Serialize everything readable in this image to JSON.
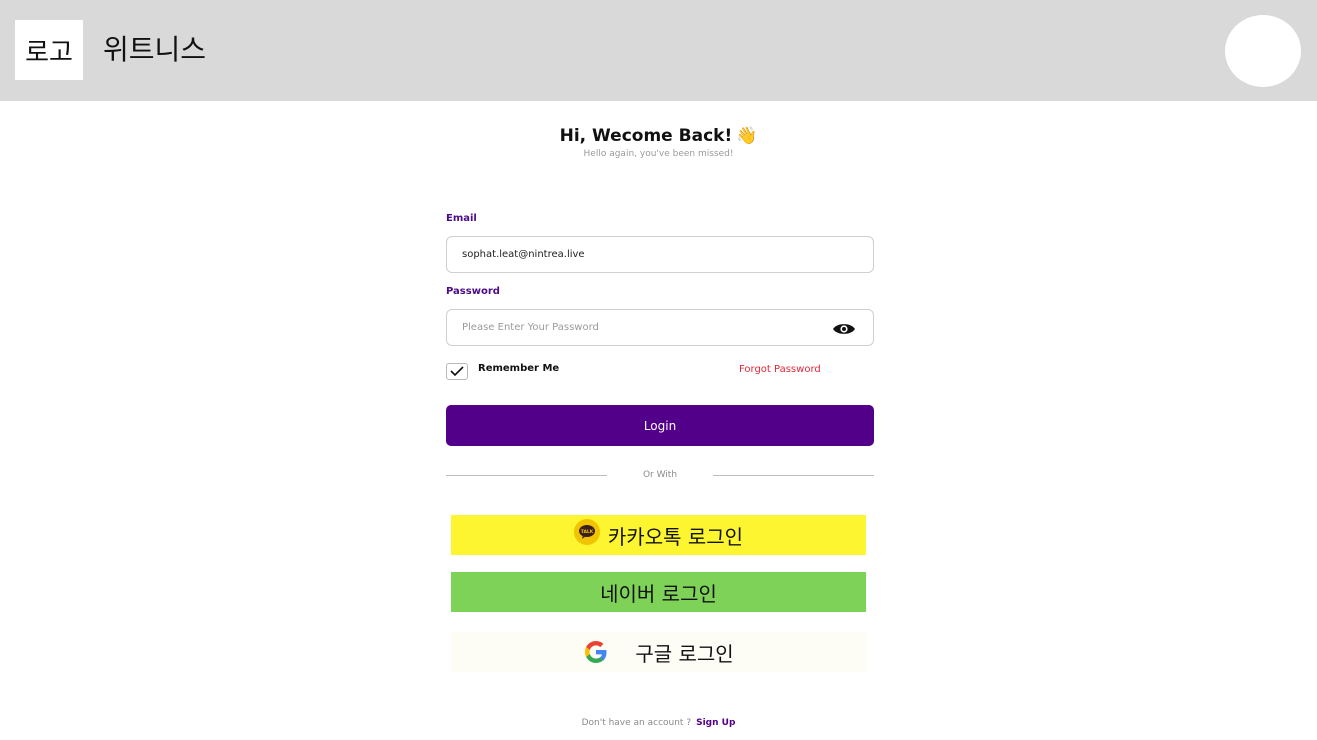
{
  "header": {
    "logo_label": "로고",
    "brand_name": "위트니스"
  },
  "greeting": {
    "title": "Hi, Wecome Back!",
    "wave_emoji": "👋",
    "subtitle": "Hello again, you've been missed!"
  },
  "form": {
    "email_label": "Email",
    "email_value": "sophat.leat@nintrea.live",
    "password_label": "Password",
    "password_placeholder": "Please Enter Your Password",
    "remember_label": "Remember Me",
    "remember_checked": true,
    "forgot_label": "Forgot Password",
    "login_label": "Login",
    "divider_label": "Or With"
  },
  "social": {
    "kakao_label": "카카오톡 로그인",
    "kakao_icon": "kakao-talk-icon",
    "naver_label": "네이버 로그인",
    "google_label": "구글 로그인",
    "google_icon": "google-g-icon"
  },
  "footer": {
    "signup_question": "Don't have an account ?",
    "signup_link": "Sign Up"
  },
  "colors": {
    "header_bg": "#d9d9d9",
    "accent": "#52008a",
    "forgot": "#e3283a",
    "kakao": "#fcf52f",
    "naver": "#7ed257",
    "google": "#fdfdf6"
  }
}
